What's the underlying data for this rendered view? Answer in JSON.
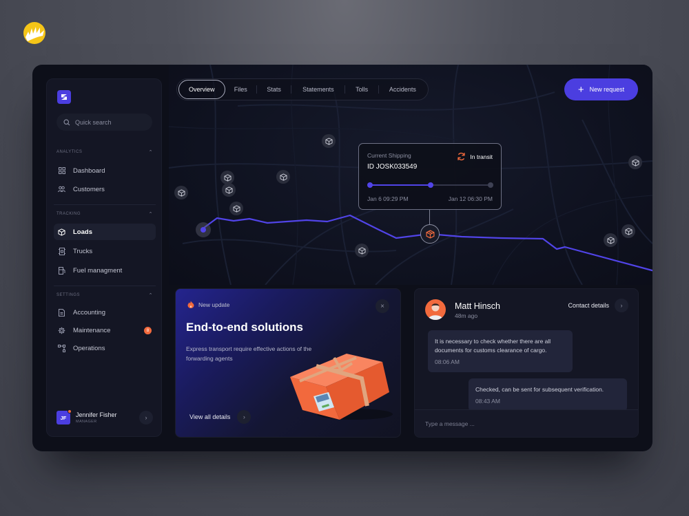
{
  "sidebar": {
    "search_placeholder": "Quick search",
    "sections": [
      {
        "title": "ANALYTICS",
        "items": [
          {
            "label": "Dashboard",
            "icon": "grid-icon"
          },
          {
            "label": "Customers",
            "icon": "users-icon"
          }
        ]
      },
      {
        "title": "TRACKING",
        "items": [
          {
            "label": "Loads",
            "icon": "box-icon",
            "active": true
          },
          {
            "label": "Trucks",
            "icon": "truck-icon"
          },
          {
            "label": "Fuel managment",
            "icon": "fuel-icon"
          }
        ]
      },
      {
        "title": "SETTINGS",
        "items": [
          {
            "label": "Accounting",
            "icon": "document-icon"
          },
          {
            "label": "Maintenance",
            "icon": "gear-icon",
            "badge": "8"
          },
          {
            "label": "Operations",
            "icon": "flow-icon"
          }
        ]
      }
    ],
    "user": {
      "initials": "JF",
      "name": "Jennifer Fisher",
      "role": "MANAGER"
    }
  },
  "tabs": [
    "Overview",
    "Files",
    "Stats",
    "Statements",
    "Tolls",
    "Accidents"
  ],
  "new_request_label": "New request",
  "shipping": {
    "label": "Current Shipping",
    "id": "ID JOSK033549",
    "status": "In transit",
    "start_date": "Jan 6 09:29 PM",
    "end_date": "Jan 12 06:30 PM",
    "progress_percent": 50
  },
  "promo": {
    "tag": "New update",
    "title": "End-to-end solutions",
    "description": "Express transport require effective actions of the forwarding agents",
    "link_label": "View all details"
  },
  "chat": {
    "name": "Matt Hinsch",
    "time_ago": "48m ago",
    "contact_label": "Contact details",
    "messages": [
      {
        "text": "It is necessary to check whether there are all documents for customs clearance of cargo.",
        "time": "08:06 AM"
      },
      {
        "text": "Checked, can be sent for subsequent verification.",
        "time": "08:43 AM"
      }
    ],
    "input_placeholder": "Type a message ..."
  },
  "colors": {
    "accent": "#4b3ee0",
    "route": "#5144e8",
    "warning": "#f26a3d",
    "background": "#0d0f19"
  }
}
